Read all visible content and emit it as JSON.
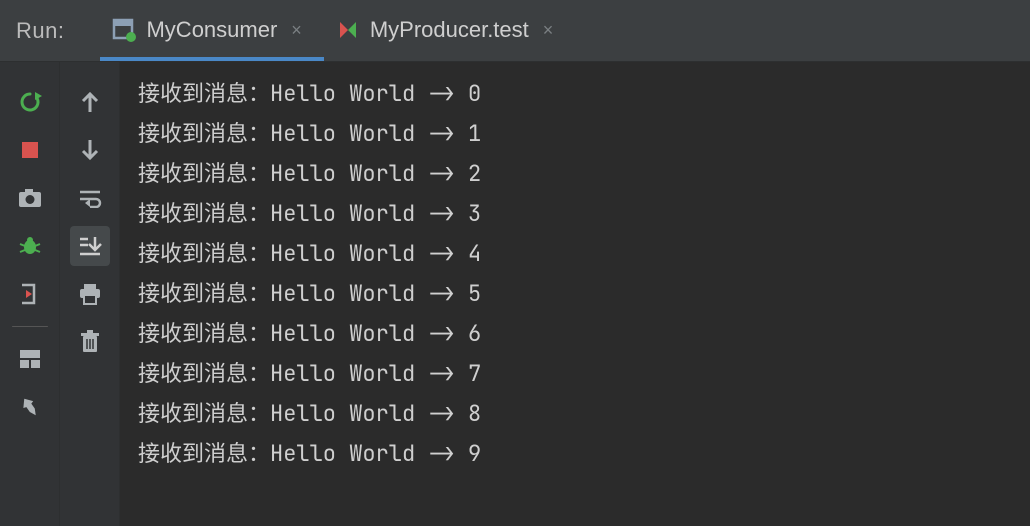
{
  "header": {
    "run_label": "Run:",
    "tabs": [
      {
        "label": "MyConsumer",
        "icon": "app-run-icon",
        "active": true
      },
      {
        "label": "MyProducer.test",
        "icon": "test-run-icon",
        "active": false
      }
    ]
  },
  "left_toolbar": [
    {
      "name": "rerun-button",
      "icon": "rerun-icon",
      "color": "#4caf50"
    },
    {
      "name": "stop-button",
      "icon": "stop-icon",
      "color": "#d9534f"
    },
    {
      "name": "dump-threads-button",
      "icon": "camera-icon",
      "color": "#aeb3b6"
    },
    {
      "name": "debug-button",
      "icon": "bug-icon",
      "color": "#4caf50"
    },
    {
      "name": "exit-button",
      "icon": "exit-icon",
      "color": "#d9534f"
    },
    {
      "name": "sep1",
      "icon": "separator"
    },
    {
      "name": "layout-button",
      "icon": "layout-icon",
      "color": "#aeb3b6"
    },
    {
      "name": "pin-button",
      "icon": "pin-icon",
      "color": "#aeb3b6"
    }
  ],
  "right_toolbar": [
    {
      "name": "scroll-up-button",
      "icon": "arrow-up-icon",
      "color": "#aeb3b6"
    },
    {
      "name": "scroll-down-button",
      "icon": "arrow-down-icon",
      "color": "#aeb3b6"
    },
    {
      "name": "soft-wrap-button",
      "icon": "soft-wrap-icon",
      "color": "#aeb3b6"
    },
    {
      "name": "scroll-to-end-button",
      "icon": "scroll-end-icon",
      "color": "#aeb3b6",
      "highlight": true
    },
    {
      "name": "print-button",
      "icon": "printer-icon",
      "color": "#aeb3b6"
    },
    {
      "name": "clear-all-button",
      "icon": "trash-icon",
      "color": "#aeb3b6"
    }
  ],
  "console": {
    "prefix": "接收到消息：Hello World -> ",
    "lines": [
      "接收到消息：Hello World -> 0",
      "接收到消息：Hello World -> 1",
      "接收到消息：Hello World -> 2",
      "接收到消息：Hello World -> 3",
      "接收到消息：Hello World -> 4",
      "接收到消息：Hello World -> 5",
      "接收到消息：Hello World -> 6",
      "接收到消息：Hello World -> 7",
      "接收到消息：Hello World -> 8",
      "接收到消息：Hello World -> 9"
    ]
  },
  "colors": {
    "bg_panel": "#3c3f41",
    "bg_console": "#2b2b2b",
    "bg_gutter": "#313335",
    "active_tab_underline": "#4a88c7",
    "green": "#4caf50",
    "red": "#d9534f",
    "text": "#cfcfcf"
  }
}
